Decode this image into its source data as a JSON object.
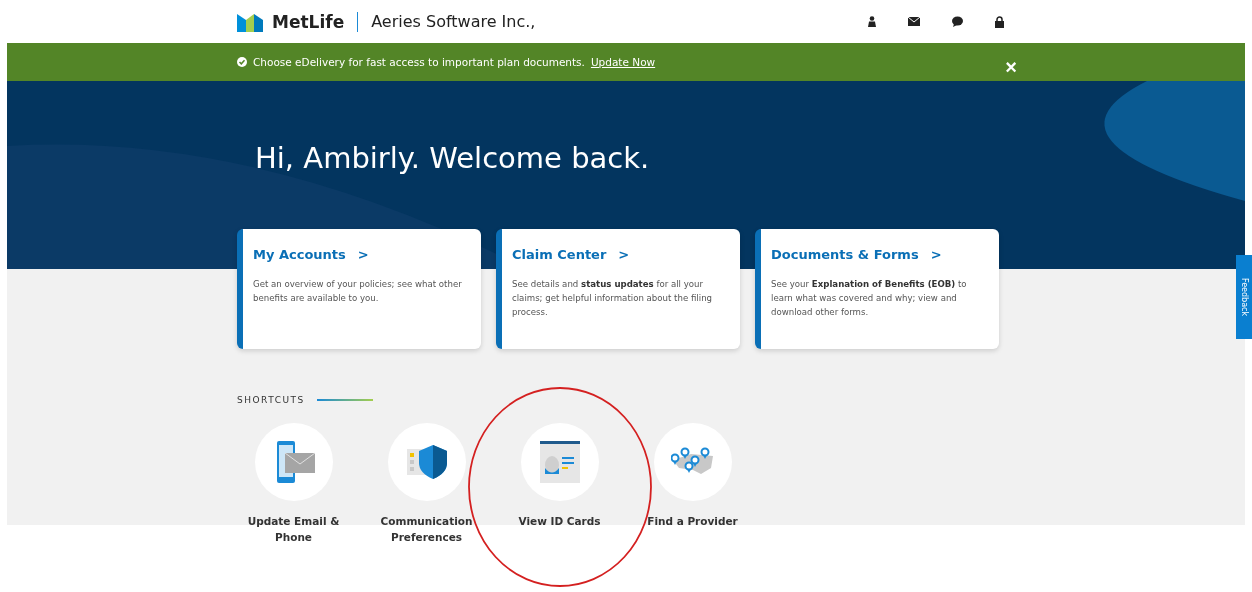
{
  "header": {
    "brand": "MetLife",
    "company": "Aeries Software Inc.,"
  },
  "banner": {
    "message": "Choose eDelivery for fast access to important plan documents.",
    "link": "Update Now",
    "close": "×"
  },
  "hero": {
    "greeting": "Hi, Ambirly. Welcome back."
  },
  "cards": [
    {
      "title": "My Accounts",
      "arrow": ">",
      "text": "Get an overview of your policies; see what other benefits are available to you."
    },
    {
      "title": "Claim Center",
      "arrow": ">",
      "text": "See details and **status updates** for all your claims; get helpful information about the filing process."
    },
    {
      "title": "Documents & Forms",
      "arrow": ">",
      "text": "See your **Explanation of Benefits (EOB)** to learn what was covered and why; view and download other forms."
    }
  ],
  "shortcuts": {
    "heading": "SHORTCUTS",
    "items": [
      {
        "label": "Update Email & Phone",
        "selected": false
      },
      {
        "label": "Communication Preferences",
        "selected": false
      },
      {
        "label": "View ID Cards",
        "selected": true
      },
      {
        "label": "Find a Provider",
        "selected": false
      }
    ]
  },
  "feedback": {
    "label": "Feedback"
  }
}
